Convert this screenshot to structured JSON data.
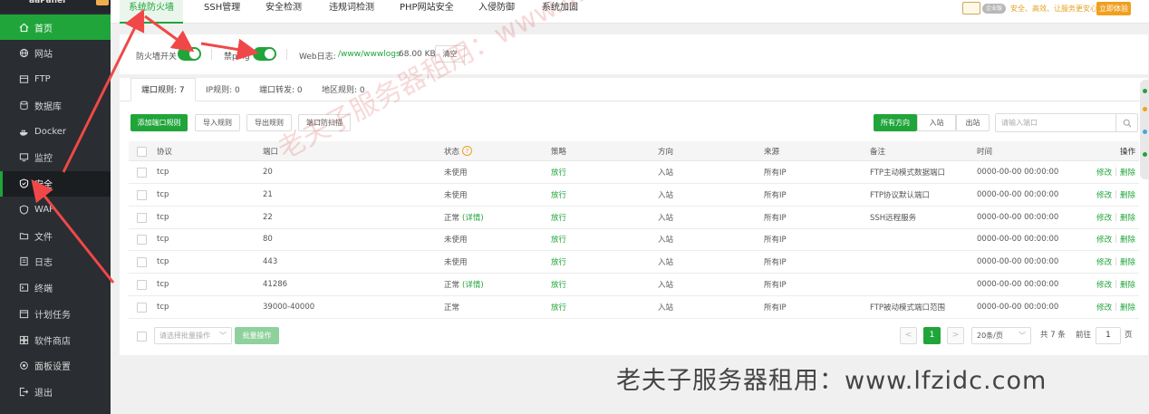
{
  "brand": {
    "name": "aaPanel"
  },
  "sidebar": {
    "items": [
      {
        "label": "首页",
        "icon": "home-icon"
      },
      {
        "label": "网站",
        "icon": "globe-icon"
      },
      {
        "label": "FTP",
        "icon": "ftp-icon"
      },
      {
        "label": "数据库",
        "icon": "database-icon"
      },
      {
        "label": "Docker",
        "icon": "docker-icon"
      },
      {
        "label": "监控",
        "icon": "monitor-icon"
      },
      {
        "label": "安全",
        "icon": "shield-icon"
      },
      {
        "label": "WAF",
        "icon": "waf-shield-icon"
      },
      {
        "label": "文件",
        "icon": "folder-icon"
      },
      {
        "label": "日志",
        "icon": "log-icon"
      },
      {
        "label": "终端",
        "icon": "terminal-icon"
      },
      {
        "label": "计划任务",
        "icon": "cron-icon"
      },
      {
        "label": "软件商店",
        "icon": "store-icon"
      },
      {
        "label": "面板设置",
        "icon": "settings-icon"
      },
      {
        "label": "退出",
        "icon": "logout-icon"
      }
    ]
  },
  "top_tabs": [
    "系统防火墙",
    "SSH管理",
    "安全检测",
    "违规词检测",
    "PHP网站安全",
    "入侵防御",
    "系统加固"
  ],
  "promo": {
    "enterprise": "企业版",
    "text": "安全、高效、让服务更安心",
    "button": "立即体验"
  },
  "settings": {
    "firewall_label": "防火墙开关",
    "ping_label": "禁ping",
    "weblog_label": "Web日志:",
    "weblog_path": "/www/wwwlogs",
    "weblog_size": "68.00 KB",
    "clear_button": "清空"
  },
  "sub_tabs": [
    "端口规则: 7",
    "IP规则: 0",
    "端口转发: 0",
    "地区规则: 0"
  ],
  "toolbar": {
    "add": "添加端口规则",
    "import": "导入规则",
    "export": "导出规则",
    "scan": "端口防扫描",
    "dir_all": "所有方向",
    "dir_in": "入站",
    "dir_out": "出站",
    "search_placeholder": "请输入端口"
  },
  "table": {
    "headers": {
      "protocol": "协议",
      "port": "端口",
      "status": "状态",
      "policy": "策略",
      "direction": "方向",
      "source": "来源",
      "remark": "备注",
      "time": "时间",
      "ops": "操作"
    },
    "rows": [
      {
        "protocol": "tcp",
        "port": "20",
        "status": "未使用",
        "detail": "",
        "policy": "放行",
        "direction": "入站",
        "source": "所有IP",
        "remark": "FTP主动模式数据端口",
        "time": "0000-00-00 00:00:00"
      },
      {
        "protocol": "tcp",
        "port": "21",
        "status": "未使用",
        "detail": "",
        "policy": "放行",
        "direction": "入站",
        "source": "所有IP",
        "remark": "FTP协议默认端口",
        "time": "0000-00-00 00:00:00"
      },
      {
        "protocol": "tcp",
        "port": "22",
        "status": "正常",
        "detail": "(详情)",
        "policy": "放行",
        "direction": "入站",
        "source": "所有IP",
        "remark": "SSH远程服务",
        "time": "0000-00-00 00:00:00"
      },
      {
        "protocol": "tcp",
        "port": "80",
        "status": "未使用",
        "detail": "",
        "policy": "放行",
        "direction": "入站",
        "source": "所有IP",
        "remark": "",
        "time": "0000-00-00 00:00:00"
      },
      {
        "protocol": "tcp",
        "port": "443",
        "status": "未使用",
        "detail": "",
        "policy": "放行",
        "direction": "入站",
        "source": "所有IP",
        "remark": "",
        "time": "0000-00-00 00:00:00"
      },
      {
        "protocol": "tcp",
        "port": "41286",
        "status": "正常",
        "detail": "(详情)",
        "policy": "放行",
        "direction": "入站",
        "source": "所有IP",
        "remark": "",
        "time": "0000-00-00 00:00:00"
      },
      {
        "protocol": "tcp",
        "port": "39000-40000",
        "status": "正常",
        "detail": "",
        "policy": "放行",
        "direction": "入站",
        "source": "所有IP",
        "remark": "FTP被动模式端口范围",
        "time": "0000-00-00 00:00:00"
      }
    ],
    "op_edit": "修改",
    "op_delete": "删除"
  },
  "footer": {
    "batch_select": "请选择批量操作",
    "batch_button": "批量操作",
    "prev": "<",
    "current_page": "1",
    "next": ">",
    "page_size": "20条/页",
    "total": "共 7 条",
    "goto_prefix": "前往",
    "goto_value": "1",
    "goto_suffix": "页"
  },
  "watermark": {
    "diagonal": "老夫子服务器租用：www.lfzidc.com",
    "bottom": "老夫子服务器租用：www.lfzidc.com"
  },
  "colors": {
    "accent": "#20a53a",
    "sidebar": "#2a2d31",
    "promo": "#f0a020",
    "arrow": "#f04848"
  }
}
